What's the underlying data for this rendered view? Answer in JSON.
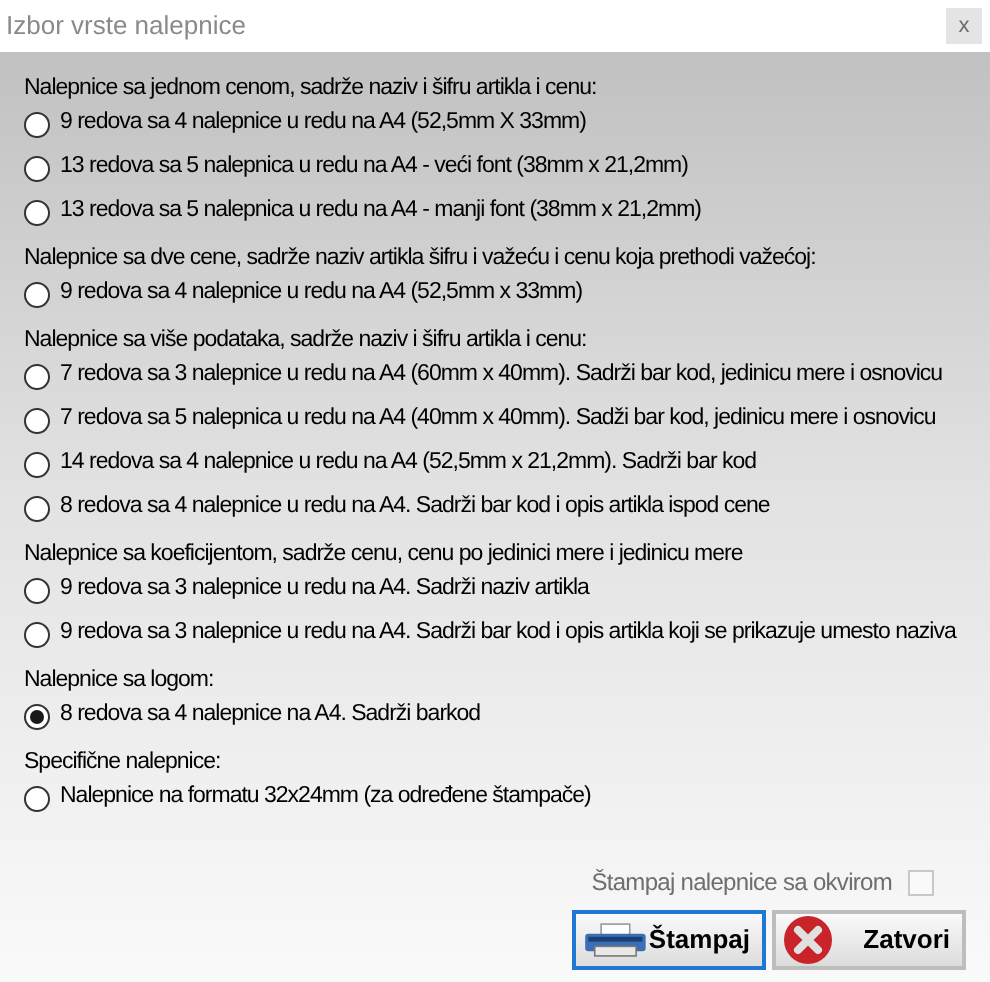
{
  "window": {
    "title": "Izbor vrste nalepnice",
    "close": "x"
  },
  "groups": [
    {
      "label": "Nalepnice sa jednom cenom, sadrže naziv i šifru artikla i cenu:",
      "options": [
        {
          "label": "9 redova sa 4 nalepnice u redu na A4 (52,5mm X 33mm)",
          "selected": false
        },
        {
          "label": "13 redova sa 5 nalepnica u redu na A4 - veći font (38mm x 21,2mm)",
          "selected": false
        },
        {
          "label": "13 redova sa 5 nalepnica u redu na A4 - manji font (38mm x 21,2mm)",
          "selected": false
        }
      ]
    },
    {
      "label": "Nalepnice sa dve cene, sadrže naziv artikla šifru i važeću i cenu koja prethodi važećoj:",
      "options": [
        {
          "label": "9 redova sa 4 nalepnice u redu na A4 (52,5mm x 33mm)",
          "selected": false
        }
      ]
    },
    {
      "label": "Nalepnice sa više podataka, sadrže naziv i šifru artikla i cenu:",
      "options": [
        {
          "label": "7 redova sa 3 nalepnice u redu na A4 (60mm x 40mm). Sadrži bar kod, jedinicu mere i osnovicu",
          "selected": false
        },
        {
          "label": "7 redova sa 5 nalepnica u redu na A4 (40mm x 40mm). Sadži bar kod, jedinicu mere i osnovicu",
          "selected": false
        },
        {
          "label": "14 redova sa 4 nalepnice u redu na A4 (52,5mm x 21,2mm). Sadrži bar kod",
          "selected": false
        },
        {
          "label": "8 redova sa 4 nalepnice u redu na A4. Sadrži bar kod i opis artikla ispod cene",
          "selected": false
        }
      ]
    },
    {
      "label": "Nalepnice sa koeficijentom, sadrže cenu, cenu po jedinici mere i jedinicu mere",
      "options": [
        {
          "label": "9 redova sa 3 nalepnice u redu na A4. Sadrži naziv artikla",
          "selected": false
        },
        {
          "label": "9 redova sa 3 nalepnice u redu na A4. Sadrži bar kod i opis artikla koji se prikazuje umesto naziva",
          "selected": false
        }
      ]
    },
    {
      "label": "Nalepnice sa logom:",
      "options": [
        {
          "label": "8 redova sa 4 nalepnice na A4. Sadrži barkod",
          "selected": true
        }
      ]
    },
    {
      "label": "Specifične nalepnice:",
      "options": [
        {
          "label": "Nalepnice na formatu 32x24mm (za određene štampače)",
          "selected": false
        }
      ]
    }
  ],
  "frame_checkbox": {
    "label": "Štampaj nalepnice sa okvirom",
    "checked": false
  },
  "buttons": [
    {
      "kind": "print",
      "label": "Štampaj",
      "focused": true
    },
    {
      "kind": "close",
      "label": "Zatvori",
      "focused": false
    }
  ]
}
